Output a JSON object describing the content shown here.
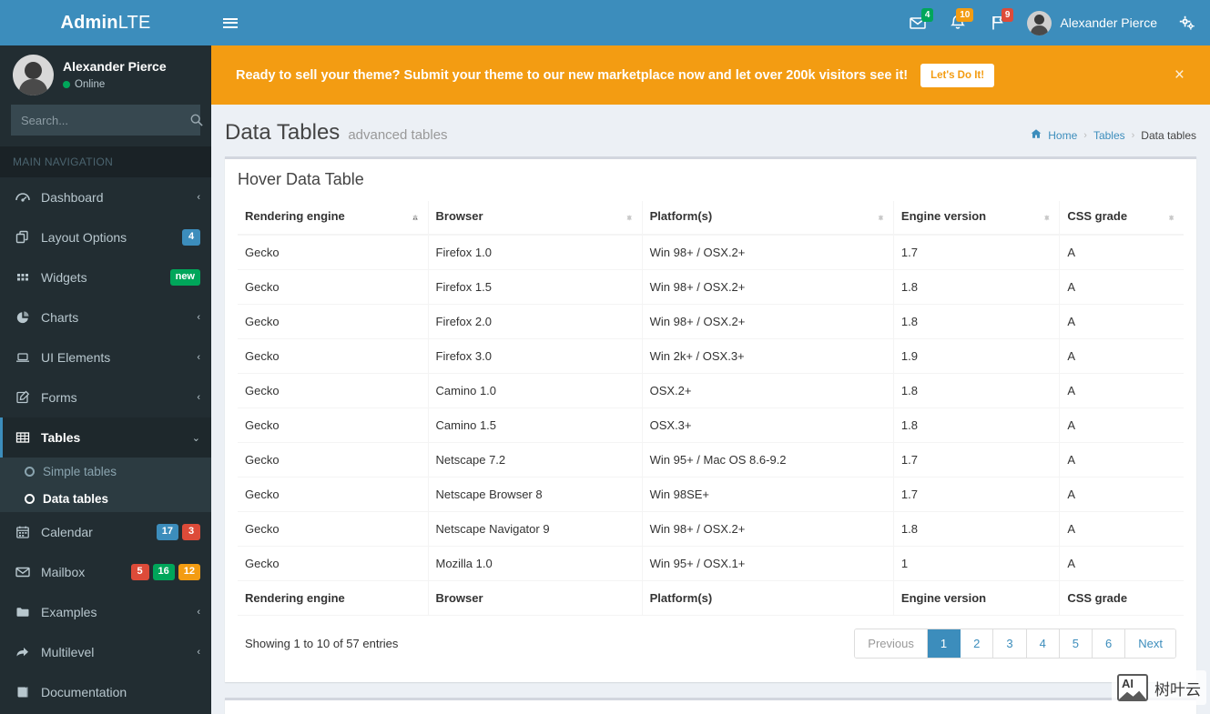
{
  "brand": {
    "bold": "Admin",
    "light": "LTE"
  },
  "colors": {
    "navbar_blue": "#3c8dbc",
    "sidebar_dark": "#222d32",
    "submenu_dark": "#2c3b41",
    "banner_orange": "#f39c12",
    "green": "#00a65a",
    "red": "#dd4b39",
    "yellow": "#f39c12",
    "content_bg": "#ecf0f5"
  },
  "sidebar": {
    "user": {
      "name": "Alexander Pierce",
      "status": "Online"
    },
    "search": {
      "value": "",
      "placeholder": "Search..."
    },
    "nav_header": "MAIN NAVIGATION",
    "items": [
      {
        "label": "Dashboard",
        "icon": "dashboard-icon",
        "caret": "‹"
      },
      {
        "label": "Layout Options",
        "icon": "layers-icon",
        "badges": [
          {
            "text": "4",
            "color": "blue"
          }
        ]
      },
      {
        "label": "Widgets",
        "icon": "grid-icon",
        "badges": [
          {
            "text": "new",
            "color": "green"
          }
        ]
      },
      {
        "label": "Charts",
        "icon": "pie-chart-icon",
        "caret": "‹"
      },
      {
        "label": "UI Elements",
        "icon": "laptop-icon",
        "caret": "‹"
      },
      {
        "label": "Forms",
        "icon": "edit-icon",
        "caret": "‹"
      },
      {
        "label": "Tables",
        "icon": "table-icon",
        "caret": "⌄",
        "active": true
      },
      {
        "label": "Calendar",
        "icon": "calendar-icon",
        "badges": [
          {
            "text": "17",
            "color": "blue"
          },
          {
            "text": "3",
            "color": "red"
          }
        ]
      },
      {
        "label": "Mailbox",
        "icon": "envelope-icon",
        "badges": [
          {
            "text": "5",
            "color": "red"
          },
          {
            "text": "16",
            "color": "green"
          },
          {
            "text": "12",
            "color": "yellow"
          }
        ]
      },
      {
        "label": "Examples",
        "icon": "folder-icon",
        "caret": "‹"
      },
      {
        "label": "Multilevel",
        "icon": "share-icon",
        "caret": "‹"
      },
      {
        "label": "Documentation",
        "icon": "book-icon"
      }
    ],
    "submenu": [
      {
        "label": "Simple tables",
        "active": false
      },
      {
        "label": "Data tables",
        "active": true
      }
    ]
  },
  "navbar": {
    "toggle": "hamburger-icon",
    "icons": [
      {
        "name": "messages-icon",
        "glyph": "envelope",
        "count": "4",
        "color": "green"
      },
      {
        "name": "notifications-icon",
        "glyph": "bell",
        "count": "10",
        "color": "yellow"
      },
      {
        "name": "tasks-icon",
        "glyph": "flag",
        "count": "9",
        "color": "red"
      }
    ],
    "user_name": "Alexander Pierce",
    "settings": "control-sidebar-icon"
  },
  "banner": {
    "text": "Ready to sell your theme? Submit your theme to our new marketplace now and let over 200k visitors see it!",
    "cta": "Let's Do It!",
    "close": "×"
  },
  "page": {
    "title": "Data Tables",
    "subtitle": "advanced tables",
    "breadcrumb": [
      {
        "label": "Home",
        "link": true,
        "icon": "home-icon"
      },
      {
        "label": "Tables",
        "link": true
      },
      {
        "label": "Data tables",
        "link": false
      }
    ]
  },
  "card": {
    "title": "Hover Data Table",
    "table": {
      "columns": [
        {
          "label": "Rendering engine",
          "sort": "asc"
        },
        {
          "label": "Browser",
          "sort": "both"
        },
        {
          "label": "Platform(s)",
          "sort": "both"
        },
        {
          "label": "Engine version",
          "sort": "both"
        },
        {
          "label": "CSS grade",
          "sort": "both"
        }
      ],
      "rows": [
        [
          "Gecko",
          "Firefox 1.0",
          "Win 98+ / OSX.2+",
          "1.7",
          "A"
        ],
        [
          "Gecko",
          "Firefox 1.5",
          "Win 98+ / OSX.2+",
          "1.8",
          "A"
        ],
        [
          "Gecko",
          "Firefox 2.0",
          "Win 98+ / OSX.2+",
          "1.8",
          "A"
        ],
        [
          "Gecko",
          "Firefox 3.0",
          "Win 2k+ / OSX.3+",
          "1.9",
          "A"
        ],
        [
          "Gecko",
          "Camino 1.0",
          "OSX.2+",
          "1.8",
          "A"
        ],
        [
          "Gecko",
          "Camino 1.5",
          "OSX.3+",
          "1.8",
          "A"
        ],
        [
          "Gecko",
          "Netscape 7.2",
          "Win 95+ / Mac OS 8.6-9.2",
          "1.7",
          "A"
        ],
        [
          "Gecko",
          "Netscape Browser 8",
          "Win 98SE+",
          "1.7",
          "A"
        ],
        [
          "Gecko",
          "Netscape Navigator 9",
          "Win 98+ / OSX.2+",
          "1.8",
          "A"
        ],
        [
          "Gecko",
          "Mozilla 1.0",
          "Win 95+ / OSX.1+",
          "1",
          "A"
        ]
      ],
      "footer_columns": [
        "Rendering engine",
        "Browser",
        "Platform(s)",
        "Engine version",
        "CSS grade"
      ]
    },
    "info": "Showing 1 to 10 of 57 entries",
    "pagination": [
      {
        "label": "Previous",
        "state": "disabled"
      },
      {
        "label": "1",
        "state": "active"
      },
      {
        "label": "2",
        "state": ""
      },
      {
        "label": "3",
        "state": ""
      },
      {
        "label": "4",
        "state": ""
      },
      {
        "label": "5",
        "state": ""
      },
      {
        "label": "6",
        "state": ""
      },
      {
        "label": "Next",
        "state": ""
      }
    ]
  },
  "watermark": {
    "badge": "AI",
    "text": "树叶云"
  }
}
